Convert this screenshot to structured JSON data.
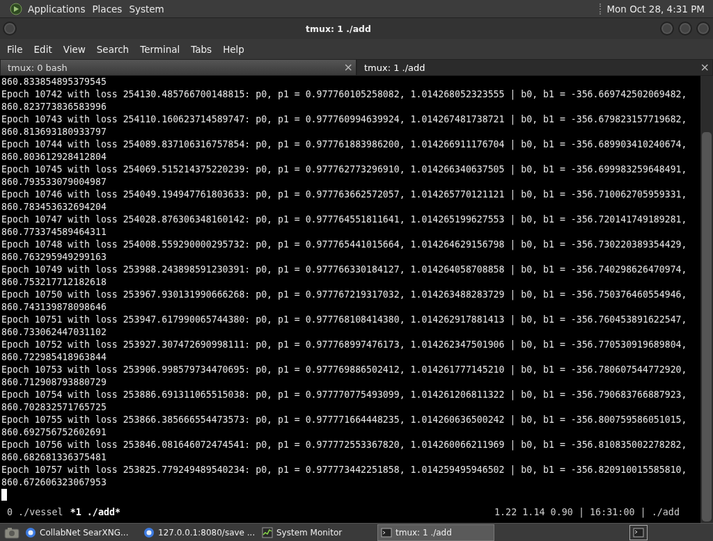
{
  "top_panel": {
    "menus": [
      "Applications",
      "Places",
      "System"
    ],
    "clock": "Mon Oct 28,  4:31 PM"
  },
  "window": {
    "title": "tmux: 1 ./add"
  },
  "menu_bar": [
    "File",
    "Edit",
    "View",
    "Search",
    "Terminal",
    "Tabs",
    "Help"
  ],
  "tabs": [
    {
      "label": "tmux: 0 bash",
      "close": "×",
      "selected": false
    },
    {
      "label": "tmux: 1 ./add",
      "close": "×",
      "selected": true
    }
  ],
  "terminal": {
    "lines": [
      "860.833854895379545",
      "Epoch 10742 with loss 254130.485766700148815: p0, p1 = 0.977760105258082, 1.014268052323555 | b0, b1 = -356.669742502069482,",
      "860.823773836583996",
      "Epoch 10743 with loss 254110.160623714589747: p0, p1 = 0.977760994639924, 1.014267481738721 | b0, b1 = -356.679823157719682,",
      "860.813693180933797",
      "Epoch 10744 with loss 254089.837106316757854: p0, p1 = 0.977761883986200, 1.014266911176704 | b0, b1 = -356.689903410240674,",
      "860.803612928412804",
      "Epoch 10745 with loss 254069.515214375220239: p0, p1 = 0.977762773296910, 1.014266340637505 | b0, b1 = -356.699983259648491,",
      "860.793533079004987",
      "Epoch 10746 with loss 254049.194947761803633: p0, p1 = 0.977763662572057, 1.014265770121121 | b0, b1 = -356.710062705959331,",
      "860.783453632694204",
      "Epoch 10747 with loss 254028.876306348160142: p0, p1 = 0.977764551811641, 1.014265199627553 | b0, b1 = -356.720141749189281,",
      "860.773374589464311",
      "Epoch 10748 with loss 254008.559290000295732: p0, p1 = 0.977765441015664, 1.014264629156798 | b0, b1 = -356.730220389354429,",
      "860.763295949299163",
      "Epoch 10749 with loss 253988.243898591230391: p0, p1 = 0.977766330184127, 1.014264058708858 | b0, b1 = -356.740298626470974,",
      "860.753217712182618",
      "Epoch 10750 with loss 253967.930131990666268: p0, p1 = 0.977767219317032, 1.014263488283729 | b0, b1 = -356.750376460554946,",
      "860.743139878098646",
      "Epoch 10751 with loss 253947.617990065744380: p0, p1 = 0.977768108414380, 1.014262917881413 | b0, b1 = -356.760453891622547,",
      "860.733062447031102",
      "Epoch 10752 with loss 253927.307472690998111: p0, p1 = 0.977768997476173, 1.014262347501906 | b0, b1 = -356.770530919689804,",
      "860.722985418963844",
      "Epoch 10753 with loss 253906.998579734470695: p0, p1 = 0.977769886502412, 1.014261777145210 | b0, b1 = -356.780607544772920,",
      "860.712908793880729",
      "Epoch 10754 with loss 253886.691311065515038: p0, p1 = 0.977770775493099, 1.014261206811322 | b0, b1 = -356.790683766887923,",
      "860.702832571765725",
      "Epoch 10755 with loss 253866.385666554473573: p0, p1 = 0.977771664448235, 1.014260636500242 | b0, b1 = -356.800759586051015,",
      "860.692756752602691",
      "Epoch 10756 with loss 253846.081646072474541: p0, p1 = 0.977772553367820, 1.014260066211969 | b0, b1 = -356.810835002278282,",
      "860.682681336375481",
      "Epoch 10757 with loss 253825.779249489540234: p0, p1 = 0.977773442251858, 1.014259495946502 | b0, b1 = -356.820910015585810,",
      "860.672606323067953"
    ]
  },
  "tmux_status": {
    "windows": [
      {
        "label": "0 ./vessel",
        "selected": false
      },
      {
        "label": "*1 ./add*",
        "selected": true
      }
    ],
    "right": "1.22 1.14 0.90 | 16:31:00 | ./add"
  },
  "taskbar": [
    {
      "label": "CollabNet SearXNG...",
      "kind": "browser",
      "selected": false
    },
    {
      "label": "127.0.0.1:8080/save ...",
      "kind": "browser",
      "selected": false
    },
    {
      "label": "System Monitor",
      "kind": "monitor",
      "selected": false
    },
    {
      "label": "tmux: 1 ./add",
      "kind": "terminal",
      "selected": true
    }
  ]
}
